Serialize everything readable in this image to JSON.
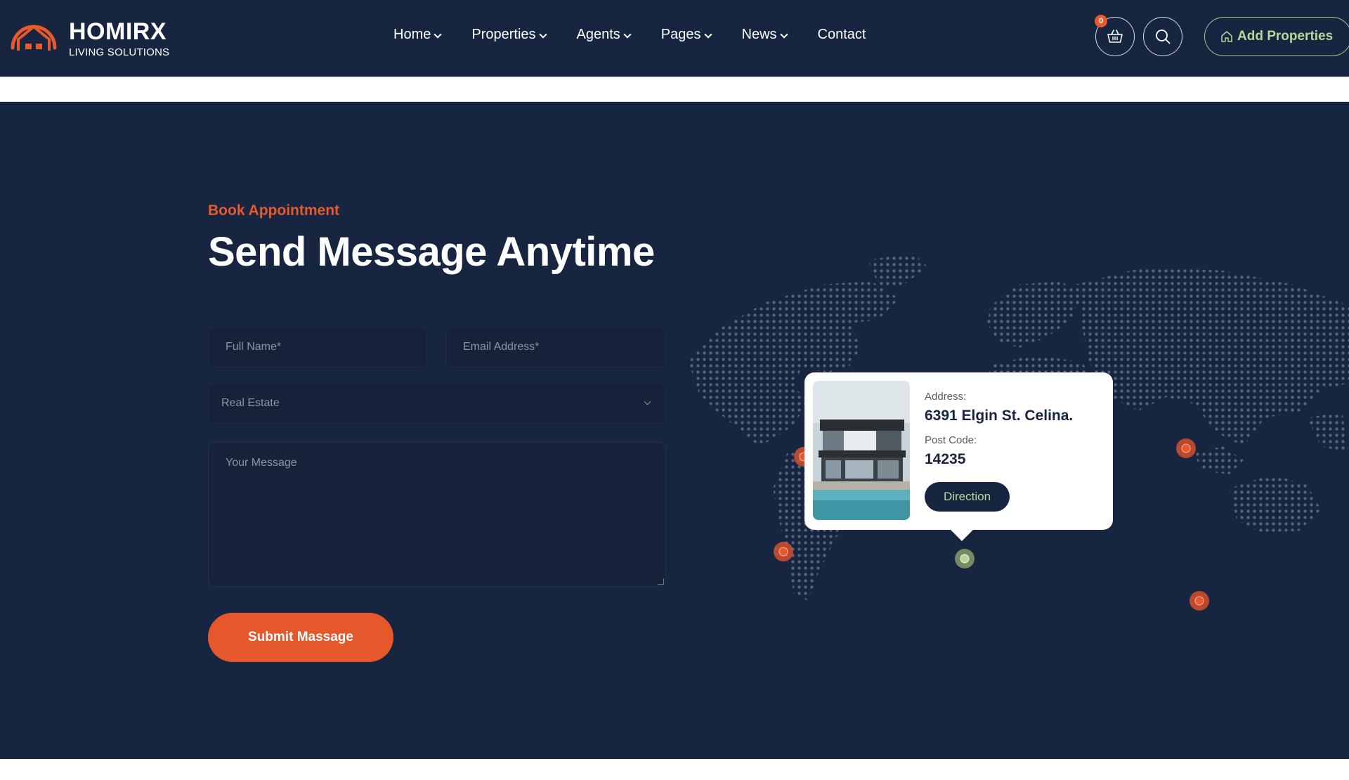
{
  "brand": {
    "name": "HOMIRX",
    "tagline": "LIVING SOLUTIONS",
    "accent_color": "#e75a2e",
    "navy": "#182540",
    "green": "#b7d89a"
  },
  "nav": {
    "items": [
      {
        "label": "Home",
        "dropdown": true
      },
      {
        "label": "Properties",
        "dropdown": true
      },
      {
        "label": "Agents",
        "dropdown": true
      },
      {
        "label": "Pages",
        "dropdown": true
      },
      {
        "label": "News",
        "dropdown": true
      },
      {
        "label": "Contact",
        "dropdown": false
      }
    ]
  },
  "header_actions": {
    "cart_count": "0",
    "cart_icon": "basket-icon",
    "search_icon": "search-icon",
    "add_properties_label": "Add Properties",
    "add_properties_icon": "home-icon"
  },
  "appointment": {
    "eyebrow": "Book Appointment",
    "title": "Send Message Anytime",
    "full_name_placeholder": "Full Name*",
    "email_placeholder": "Email Address*",
    "select_value": "Real Estate",
    "message_placeholder": "Your Message",
    "submit_label": "Submit Massage"
  },
  "location_card": {
    "address_label": "Address:",
    "address_value": "6391 Elgin St. Celina.",
    "postcode_label": "Post Code:",
    "postcode_value": "14235",
    "direction_label": "Direction"
  }
}
